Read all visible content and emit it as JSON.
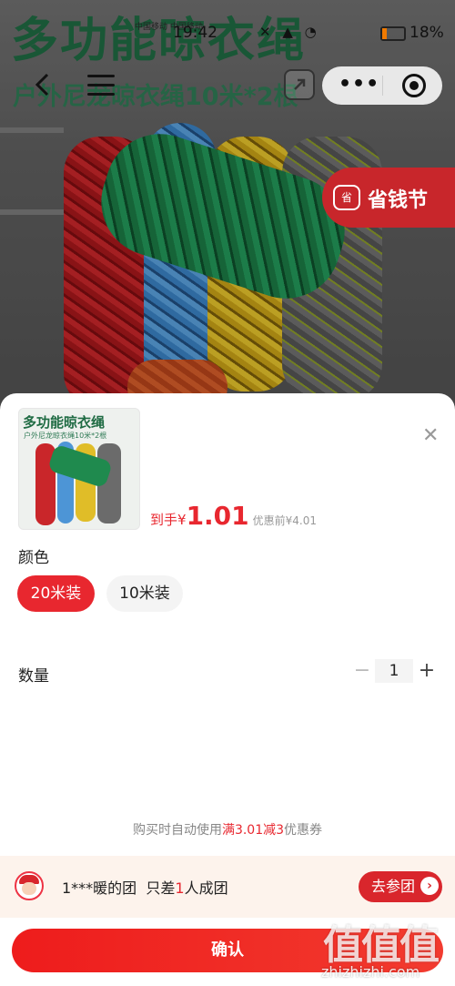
{
  "status_bar": {
    "carrier": "中国移动 中国移动",
    "time": "19:42",
    "icons": "✕ ▲ ◔",
    "battery": "18%"
  },
  "hero": {
    "title": "多功能晾衣绳",
    "subtitle": "户外尼龙晾衣绳10米*2根",
    "promo_tag": "省钱节",
    "promo_logo": "省"
  },
  "nav": {
    "back_icon": "chevron-left-icon",
    "menu_icon": "hamburger-menu-icon",
    "share_icon": "share-icon",
    "more_dots": "•••",
    "mini_program_icon": "target-icon"
  },
  "product": {
    "thumb_title": "多功能晾衣绳",
    "thumb_sub": "户外尼龙晾衣绳10米*2根",
    "price_label": "到手",
    "currency": "¥",
    "price": "1.01",
    "original_price": "优惠前¥4.01",
    "close": "✕"
  },
  "options": {
    "color_label": "颜色",
    "items": [
      {
        "label": "20米装",
        "selected": true
      },
      {
        "label": "10米装",
        "selected": false
      }
    ]
  },
  "quantity": {
    "label": "数量",
    "minus": "−",
    "value": "1",
    "plus": "+"
  },
  "coupon": {
    "prefix": "购买时自动使用",
    "highlight": "满3.01减3",
    "suffix": "优惠券"
  },
  "group": {
    "user": "1***暖的团",
    "text_before": "只差",
    "highlight": "1",
    "text_after": "人成团",
    "join_label": "去参团",
    "arrow": "›"
  },
  "confirm": {
    "label": "确认"
  },
  "watermark": {
    "logo": "值值值",
    "url": "zhizhizhi.com"
  },
  "colors": {
    "accent": "#e8272f",
    "green_title": "#1f6b43",
    "promo_red": "#c8262b"
  }
}
